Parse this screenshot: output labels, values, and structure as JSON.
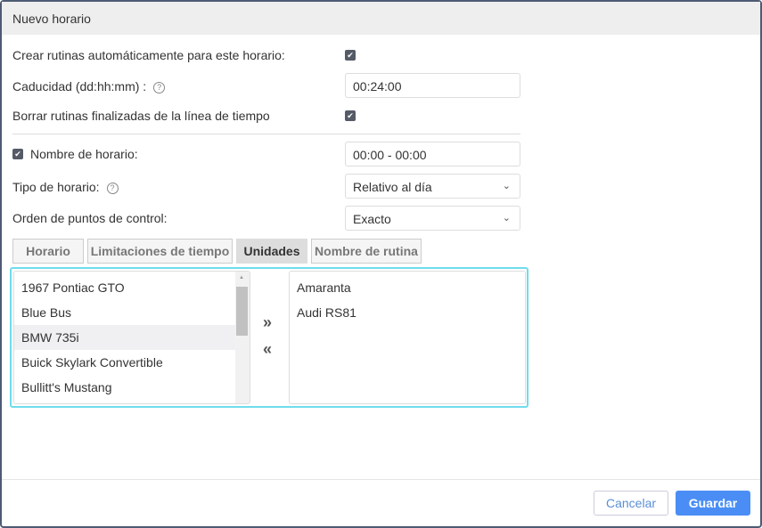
{
  "title": "Nuevo horario",
  "fields": {
    "crear_label": "Crear rutinas automáticamente para este horario:",
    "caducidad_label": "Caducidad (dd:hh:mm)  :",
    "caducidad_value": "00:24:00",
    "borrar_label": "Borrar rutinas finalizadas de la línea de tiempo",
    "nombre_label": "Nombre de horario:",
    "nombre_value": "00:00 - 00:00",
    "tipo_label": "Tipo de horario:",
    "tipo_value": "Relativo al día",
    "orden_label": "Orden de puntos de control:",
    "orden_value": "Exacto"
  },
  "tabs": [
    "Horario",
    "Limitaciones de tiempo",
    "Unidades",
    "Nombre de rutina"
  ],
  "available_units": [
    "1967 Pontiac GTO",
    "Blue Bus",
    "BMW 735i",
    "Buick Skylark Convertible",
    "Bullitt's Mustang"
  ],
  "selected_units": [
    "Amaranta",
    "Audi RS81"
  ],
  "move_right": "»",
  "move_left": "«",
  "footer": {
    "cancel": "Cancelar",
    "save": "Guardar"
  },
  "colors": {
    "accent": "#4a8ef5",
    "panel_border": "#6fdcec"
  }
}
